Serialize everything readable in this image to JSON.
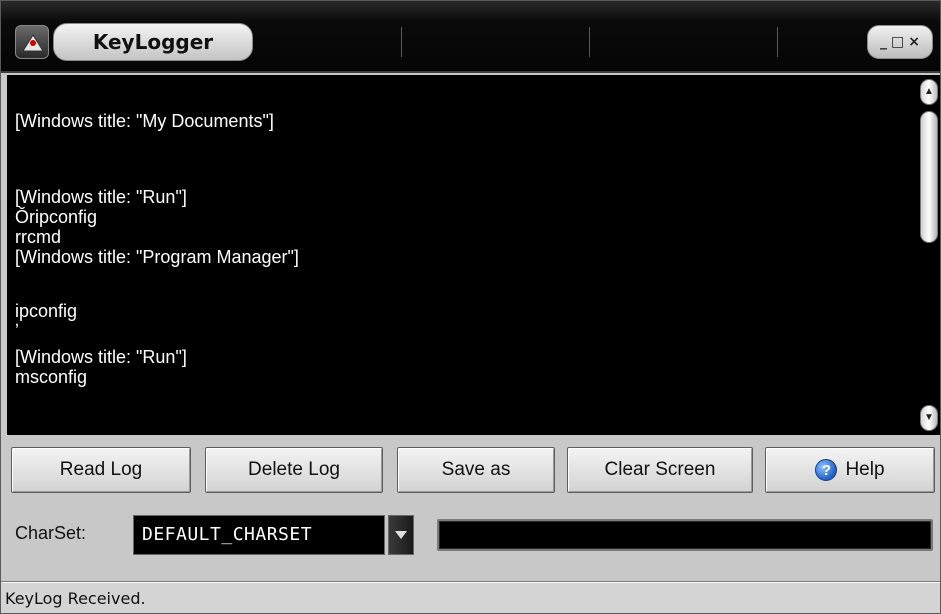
{
  "window": {
    "title": "KeyLogger",
    "controls": {
      "minimize": "_",
      "maximize": "□",
      "close": "×"
    },
    "icon": "app-logo-icon"
  },
  "log": {
    "lines": [
      "[Windows title: \"My Documents\"]",
      "",
      "",
      "[Windows title: \"Run\"]",
      "Ŏripconfig",
      "rrcmd",
      "[Windows title: \"Program Manager\"]",
      "",
      "ipconfig",
      "ʼ",
      "[Windows title: \"Run\"]",
      "msconfig"
    ]
  },
  "scrollbar": {
    "up_icon": "scroll-up-icon",
    "down_icon": "scroll-down-icon"
  },
  "buttons": {
    "read_log": "Read Log",
    "delete_log": "Delete Log",
    "save_as": "Save as",
    "clear_screen": "Clear Screen",
    "help": "Help",
    "help_icon": "help-icon"
  },
  "charset": {
    "label": "CharSet:",
    "value": "DEFAULT_CHARSET"
  },
  "progress": {
    "value": 0
  },
  "status": {
    "text": "KeyLog Received."
  },
  "colors": {
    "log_background": "#000000",
    "log_text": "#ffffff",
    "window_chrome": "#c8c8c8",
    "titlebar": "#0a0a0a"
  }
}
